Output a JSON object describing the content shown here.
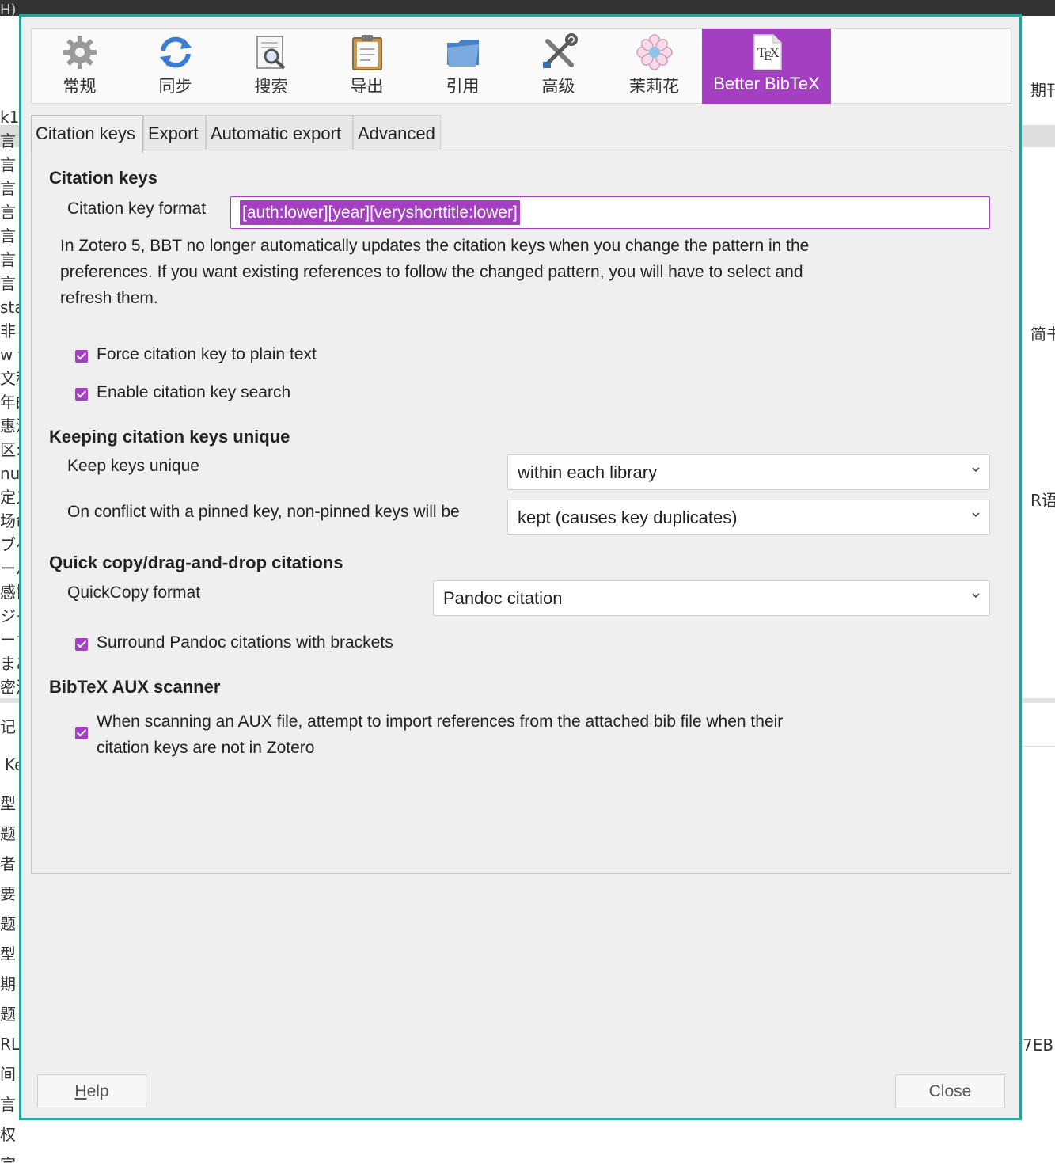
{
  "background": {
    "topbar_text": "H)",
    "left_rows": [
      "k1",
      "言",
      "言",
      "言",
      "言",
      "言",
      "言",
      "言",
      "sta",
      "非",
      "w t",
      "文科",
      "年的",
      "惠温",
      "区:",
      "nue",
      "定义",
      "场命",
      "ブペ",
      "ーパ",
      "感情",
      "ジャ",
      "ーサ",
      "まあ",
      "密活",
      "记",
      "Ke",
      "型",
      "题",
      "者",
      "要",
      "题",
      "型",
      "期",
      "题",
      "RL",
      "间",
      "言",
      "权",
      "宗"
    ],
    "right_rows": [
      "期刊",
      "简书",
      "R语",
      "7EB"
    ]
  },
  "dialog": {
    "panes": [
      {
        "label": "常规",
        "icon": "gear-icon"
      },
      {
        "label": "同步",
        "icon": "sync-icon"
      },
      {
        "label": "搜索",
        "icon": "search-document-icon"
      },
      {
        "label": "导出",
        "icon": "clipboard-icon"
      },
      {
        "label": "引用",
        "icon": "folder-icon"
      },
      {
        "label": "高级",
        "icon": "tools-icon"
      },
      {
        "label": "茉莉花",
        "icon": "flower-icon"
      },
      {
        "label": "Better BibTeX",
        "icon": "tex-document-icon",
        "active": true
      }
    ],
    "tabs": [
      {
        "label": "Citation keys",
        "active": true
      },
      {
        "label": "Export"
      },
      {
        "label": "Automatic export"
      },
      {
        "label": "Advanced"
      }
    ],
    "citation_keys": {
      "heading": "Citation keys",
      "format_label": "Citation key format",
      "format_value": "[auth:lower][year][veryshorttitle:lower]",
      "info_text": "In Zotero 5, BBT no longer automatically updates the citation keys when you change the pattern in the preferences. If you want existing references to follow the changed pattern, you will have to select and refresh them.",
      "force_plain_label": "Force citation key to plain text",
      "force_plain_checked": true,
      "enable_search_label": "Enable citation key search",
      "enable_search_checked": true
    },
    "unique": {
      "heading": "Keeping citation keys unique",
      "keep_label": "Keep keys unique",
      "keep_value": "within each library",
      "conflict_label": "On conflict with a pinned key, non-pinned keys will be",
      "conflict_value": "kept (causes key duplicates)"
    },
    "quickcopy": {
      "heading": "Quick copy/drag-and-drop citations",
      "format_label": "QuickCopy format",
      "format_value": "Pandoc citation",
      "brackets_label": "Surround Pandoc citations with brackets",
      "brackets_checked": true
    },
    "aux": {
      "heading": "BibTeX AUX scanner",
      "import_label": "When scanning an AUX file, attempt to import references from the attached bib file when their citation keys are not in Zotero",
      "import_checked": true
    },
    "buttons": {
      "help_accesskey": "H",
      "help_rest": "elp",
      "close": "Close"
    },
    "accent_color": "#a33fc0",
    "frame_color": "#2aa198"
  }
}
